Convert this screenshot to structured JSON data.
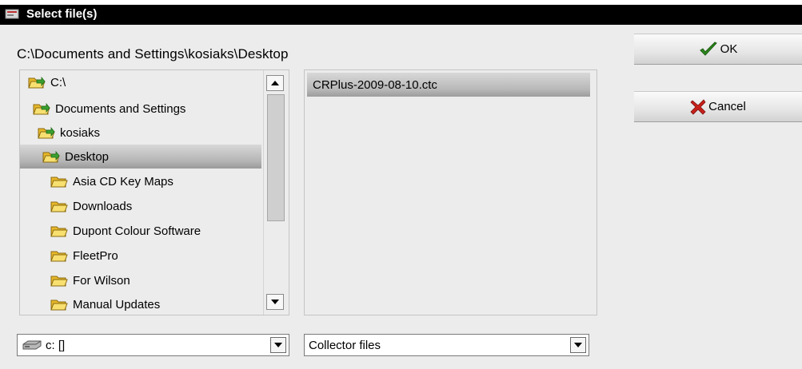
{
  "window": {
    "title": "Select file(s)"
  },
  "current_path": "C:\\Documents and Settings\\kosiaks\\Desktop",
  "folder_tree": {
    "items": [
      {
        "label": "C:\\",
        "icon": "open-folder-icon",
        "selected": false
      },
      {
        "label": "Documents and Settings",
        "icon": "open-folder-icon",
        "selected": false
      },
      {
        "label": "kosiaks",
        "icon": "open-folder-icon",
        "selected": false
      },
      {
        "label": "Desktop",
        "icon": "open-folder-icon",
        "selected": true
      },
      {
        "label": "Asia CD Key Maps",
        "icon": "folder-icon",
        "selected": false
      },
      {
        "label": "Downloads",
        "icon": "folder-icon",
        "selected": false
      },
      {
        "label": "Dupont Colour Software",
        "icon": "folder-icon",
        "selected": false
      },
      {
        "label": "FleetPro",
        "icon": "folder-icon",
        "selected": false
      },
      {
        "label": "For Wilson",
        "icon": "folder-icon",
        "selected": false
      },
      {
        "label": "Manual Updates",
        "icon": "folder-icon",
        "selected": false
      }
    ]
  },
  "file_list": {
    "items": [
      {
        "label": "CRPlus-2009-08-10.ctc",
        "selected": true
      }
    ]
  },
  "buttons": {
    "ok_label": "OK",
    "cancel_label": "Cancel"
  },
  "drive_select": {
    "value": "c: []",
    "icon": "drive-icon"
  },
  "filter_select": {
    "value": "Collector files"
  },
  "colors": {
    "titlebar": "#000000",
    "dialog_bg": "#ececec",
    "ok_check": "#2e8b1e",
    "cancel_x": "#c8201a",
    "folder": "#f5d040"
  }
}
